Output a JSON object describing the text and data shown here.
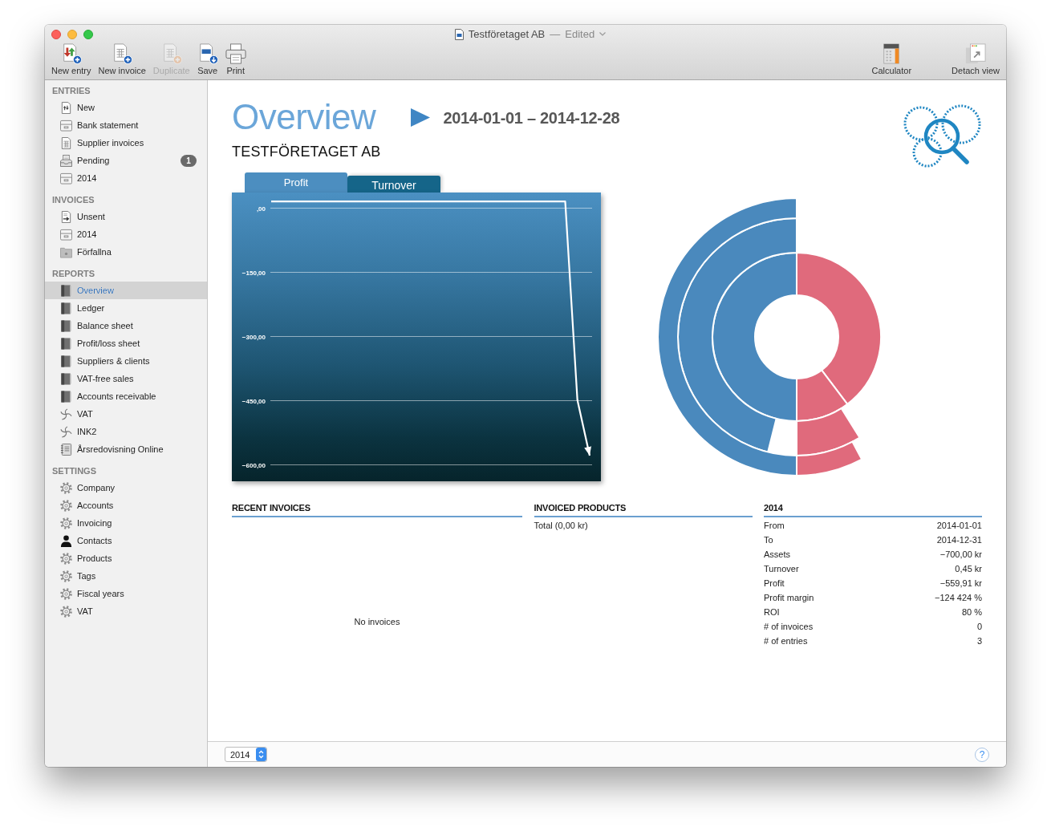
{
  "window": {
    "title": "Testföretaget AB",
    "separator": "—",
    "status": "Edited"
  },
  "toolbar": {
    "left": [
      {
        "kind": "entry",
        "label": "New entry",
        "disabled": false
      },
      {
        "kind": "invoice",
        "label": "New invoice",
        "disabled": false
      },
      {
        "kind": "duplicate",
        "label": "Duplicate",
        "disabled": true
      },
      {
        "kind": "save",
        "label": "Save",
        "disabled": false
      },
      {
        "kind": "print",
        "label": "Print",
        "disabled": false
      }
    ],
    "right": [
      {
        "kind": "calculator",
        "label": "Calculator",
        "disabled": false
      },
      {
        "kind": "detach",
        "label": "Detach view",
        "disabled": false
      }
    ]
  },
  "sidebar": {
    "sections": [
      {
        "title": "ENTRIES",
        "items": [
          {
            "kind": "entry",
            "label": "New",
            "selected": false
          },
          {
            "kind": "drawer",
            "label": "Bank statement",
            "selected": false
          },
          {
            "kind": "sheet",
            "label": "Supplier invoices",
            "selected": false
          },
          {
            "kind": "tray",
            "label": "Pending",
            "selected": false,
            "badge": "1"
          },
          {
            "kind": "drawer",
            "label": "2014",
            "selected": false
          }
        ]
      },
      {
        "title": "INVOICES",
        "items": [
          {
            "kind": "send",
            "label": "Unsent",
            "selected": false
          },
          {
            "kind": "drawer",
            "label": "2014",
            "selected": false
          },
          {
            "kind": "folder",
            "label": "Förfallna",
            "selected": false
          }
        ]
      },
      {
        "title": "REPORTS",
        "items": [
          {
            "kind": "book",
            "label": "Overview",
            "selected": true
          },
          {
            "kind": "book",
            "label": "Ledger",
            "selected": false
          },
          {
            "kind": "book",
            "label": "Balance sheet",
            "selected": false
          },
          {
            "kind": "book",
            "label": "Profit/loss sheet",
            "selected": false
          },
          {
            "kind": "book",
            "label": "Suppliers & clients",
            "selected": false
          },
          {
            "kind": "book",
            "label": "VAT-free sales",
            "selected": false
          },
          {
            "kind": "book",
            "label": "Accounts receivable",
            "selected": false
          },
          {
            "kind": "swirl",
            "label": "VAT",
            "selected": false
          },
          {
            "kind": "swirl",
            "label": "INK2",
            "selected": false
          },
          {
            "kind": "notebook",
            "label": "Årsredovisning Online",
            "selected": false
          }
        ]
      },
      {
        "title": "SETTINGS",
        "items": [
          {
            "kind": "gear",
            "label": "Company",
            "selected": false
          },
          {
            "kind": "gear",
            "label": "Accounts",
            "selected": false
          },
          {
            "kind": "gear",
            "label": "Invoicing",
            "selected": false
          },
          {
            "kind": "person",
            "label": "Contacts",
            "selected": false
          },
          {
            "kind": "gear",
            "label": "Products",
            "selected": false
          },
          {
            "kind": "gear",
            "label": "Tags",
            "selected": false
          },
          {
            "kind": "gear",
            "label": "Fiscal years",
            "selected": false
          },
          {
            "kind": "gear",
            "label": "VAT",
            "selected": false
          }
        ]
      }
    ]
  },
  "overview": {
    "title": "Overview",
    "period": "2014-01-01 – 2014-12-28",
    "company": "TESTFÖRETAGET AB"
  },
  "chart_panel": {
    "tabs": [
      {
        "label": "Profit",
        "selected": true
      },
      {
        "label": "Turnover",
        "selected": false
      }
    ],
    "chart_data": {
      "type": "line",
      "categories": [
        null,
        null,
        null,
        null,
        null,
        null,
        null,
        null,
        null,
        null,
        null,
        null,
        null,
        null,
        null,
        null,
        null,
        null,
        null,
        null,
        null,
        null,
        null,
        null,
        null,
        null,
        null
      ],
      "values": [
        15,
        15,
        15,
        15,
        15,
        15,
        15,
        15,
        15,
        15,
        15,
        15,
        15,
        15,
        15,
        15,
        15,
        15,
        15,
        15,
        15,
        15,
        15,
        15,
        15,
        -450,
        -580
      ],
      "ylim": [
        -640,
        36
      ],
      "yticks": [
        {
          "value": 0,
          "label": ",00"
        },
        {
          "value": -150,
          "label": "−150,00"
        },
        {
          "value": -300,
          "label": "−300,00"
        },
        {
          "value": -450,
          "label": "−450,00"
        },
        {
          "value": -600,
          "label": "−600,00"
        }
      ],
      "grid": true
    }
  },
  "recent_invoices": {
    "title": "RECENT INVOICES",
    "empty_text": "No invoices"
  },
  "invoiced_products": {
    "title": "INVOICED PRODUCTS",
    "total": "Total (0,00 kr)"
  },
  "summary": {
    "title": "2014",
    "rows": [
      {
        "label": "From",
        "value": "2014-01-01"
      },
      {
        "label": "To",
        "value": "2014-12-31"
      },
      {
        "label": "Assets",
        "value": "−700,00 kr"
      },
      {
        "label": "Turnover",
        "value": "0,45 kr"
      },
      {
        "label": "Profit",
        "value": "−559,91 kr"
      },
      {
        "label": "Profit margin",
        "value": "−124 424 %"
      },
      {
        "label": "ROI",
        "value": "80 %"
      },
      {
        "label": "# of invoices",
        "value": "0"
      },
      {
        "label": "# of entries",
        "value": "3"
      }
    ]
  },
  "footer": {
    "year": "2014",
    "help": "?"
  }
}
